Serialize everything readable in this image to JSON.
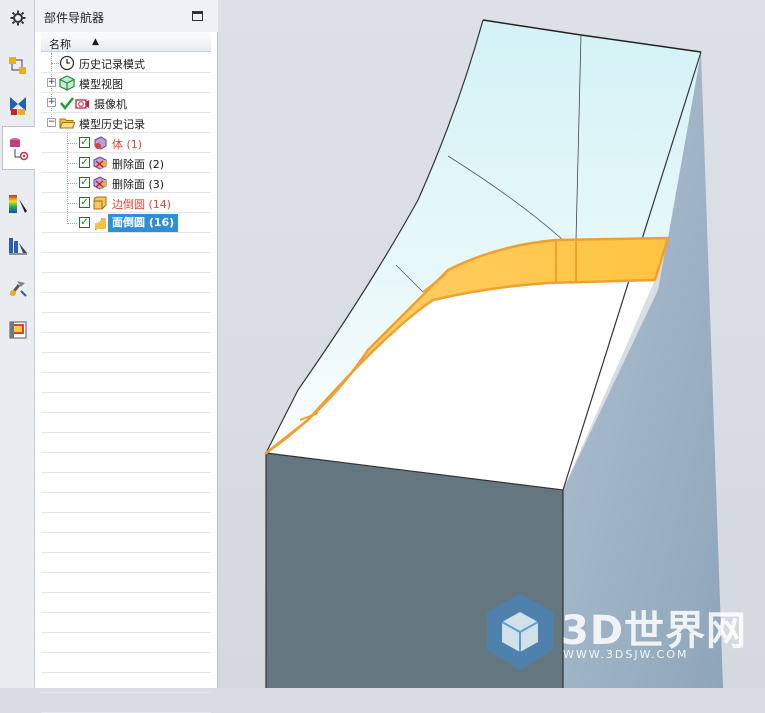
{
  "panel": {
    "title": "部件导航器",
    "column_header": "名称",
    "sort_indicator": "▲"
  },
  "tree": [
    {
      "label": "历史记录模式"
    },
    {
      "label": "模型视图",
      "expander": "+"
    },
    {
      "label": "摄像机",
      "expander": "+"
    },
    {
      "label": "模型历史记录",
      "expander": "−"
    },
    {
      "label": "体 (1)",
      "checked": true
    },
    {
      "label": "删除面 (2)",
      "checked": true
    },
    {
      "label": "删除面 (3)",
      "checked": true
    },
    {
      "label": "边倒圆 (14)",
      "checked": true
    },
    {
      "label": "面倒圆 (16)",
      "checked": true,
      "selected": true
    }
  ],
  "toolbar_icons": [
    "settings-gear-icon",
    "assembly-navigator-icon",
    "constraint-navigator-icon",
    "part-navigator-icon",
    "color-palette-icon",
    "reuse-library-icon",
    "hd3d-tools-icon",
    "web-browser-icon"
  ],
  "watermark": {
    "brand": "3D世界网",
    "url": "WWW.3DSJW.COM"
  },
  "colors": {
    "selection": "#2d8fd8",
    "highlight_face": "#ffc84a",
    "highlight_edge": "#f0a030",
    "warning_text": "#e0443a"
  }
}
